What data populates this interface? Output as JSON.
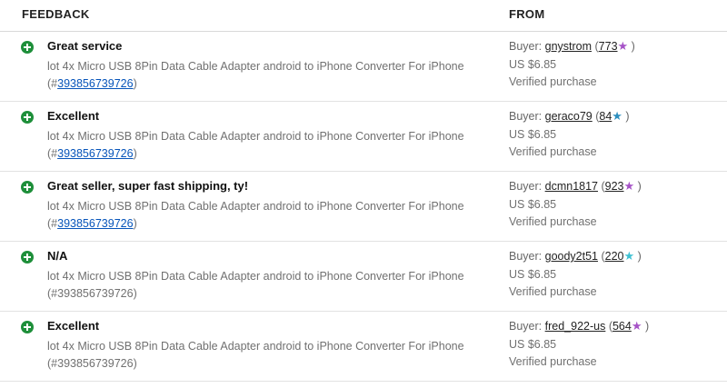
{
  "header": {
    "feedback": "FEEDBACK",
    "from": "FROM"
  },
  "rows": [
    {
      "comment": "Great service",
      "item_text": "lot 4x Micro USB 8Pin Data Cable Adapter android to iPhone Converter For iPhone",
      "item_id": "393856739726",
      "item_id_linked": true,
      "buyer_prefix": "Buyer:",
      "buyer": "gnystrom",
      "score": "773",
      "star_color": "#a653c7",
      "price": "US $6.85",
      "verified": "Verified purchase"
    },
    {
      "comment": "Excellent",
      "item_text": "lot 4x Micro USB 8Pin Data Cable Adapter android to iPhone Converter For iPhone",
      "item_id": "393856739726",
      "item_id_linked": true,
      "buyer_prefix": "Buyer:",
      "buyer": "geraco79",
      "score": "84",
      "star_color": "#2d8fbf",
      "price": "US $6.85",
      "verified": "Verified purchase"
    },
    {
      "comment": "Great seller, super fast shipping, ty!",
      "item_text": "lot 4x Micro USB 8Pin Data Cable Adapter android to iPhone Converter For iPhone",
      "item_id": "393856739726",
      "item_id_linked": true,
      "buyer_prefix": "Buyer:",
      "buyer": "dcmn1817",
      "score": "923",
      "star_color": "#a653c7",
      "price": "US $6.85",
      "verified": "Verified purchase"
    },
    {
      "comment": "N/A",
      "item_text": "lot 4x Micro USB 8Pin Data Cable Adapter android to iPhone Converter For iPhone",
      "item_id": "393856739726",
      "item_id_linked": false,
      "buyer_prefix": "Buyer:",
      "buyer": "goody2t51",
      "score": "220",
      "star_color": "#3fc1d3",
      "price": "US $6.85",
      "verified": "Verified purchase"
    },
    {
      "comment": "Excellent",
      "item_text": "lot 4x Micro USB 8Pin Data Cable Adapter android to iPhone Converter For iPhone",
      "item_id": "393856739726",
      "item_id_linked": false,
      "buyer_prefix": "Buyer:",
      "buyer": "fred_922-us",
      "score": "564",
      "star_color": "#a653c7",
      "price": "US $6.85",
      "verified": "Verified purchase"
    }
  ],
  "icons": {
    "positive": "positive-feedback-icon",
    "star": "star-icon"
  }
}
